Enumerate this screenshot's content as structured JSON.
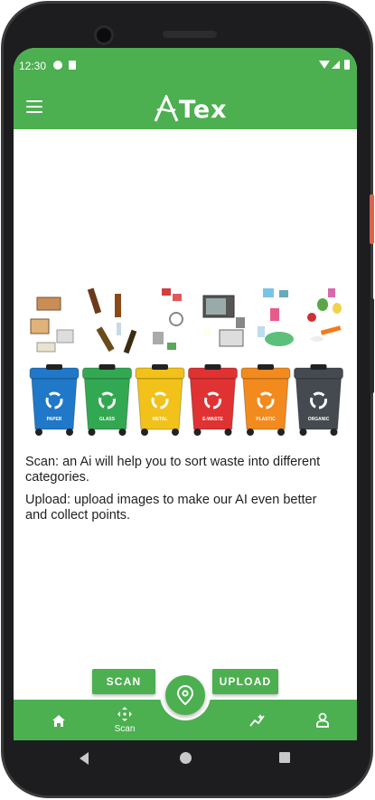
{
  "status_bar": {
    "time": "12:30"
  },
  "app_bar": {
    "title": "Tex",
    "logo_glyph": "A"
  },
  "illustration": {
    "bins": [
      {
        "label": "PAPER",
        "color": "#1f78c8"
      },
      {
        "label": "GLASS",
        "color": "#33a852"
      },
      {
        "label": "METAL",
        "color": "#f2c21a"
      },
      {
        "label": "E-WASTE",
        "color": "#e03232"
      },
      {
        "label": "PLASTIC",
        "color": "#f28a1e"
      },
      {
        "label": "ORGANIC",
        "color": "#444a4f"
      }
    ]
  },
  "info": {
    "scan_text": "Scan: an Ai will help you to sort waste into different categories.",
    "upload_text": "Upload: upload images to make our AI even better and collect points."
  },
  "actions": {
    "scan_label": "SCAN",
    "upload_label": "UPLOAD"
  },
  "bottom_nav": {
    "scan_label": "Scan"
  },
  "colors": {
    "primary": "#4caf50",
    "text": "#1f1f1f"
  }
}
